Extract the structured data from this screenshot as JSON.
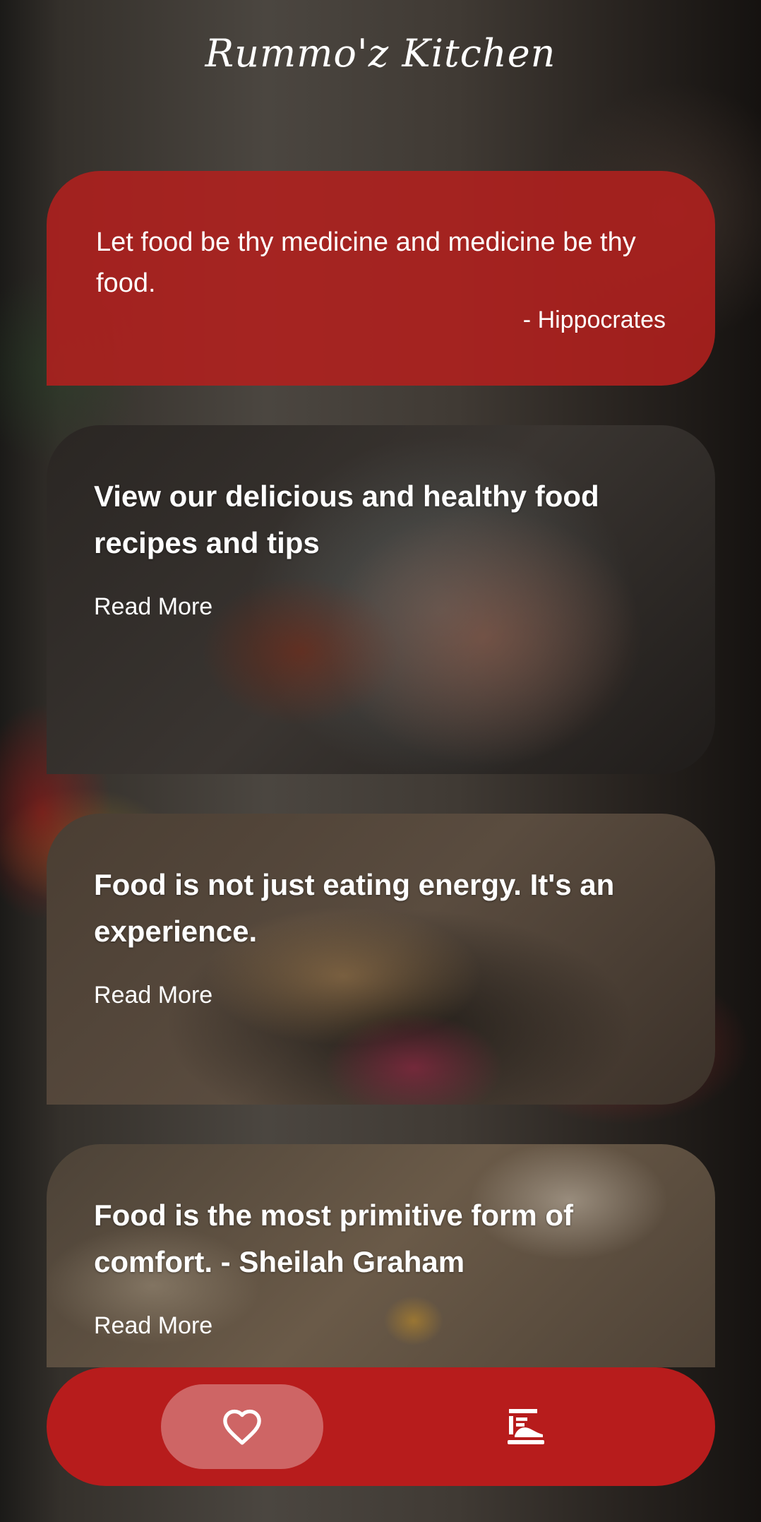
{
  "app": {
    "title": "Rummo'z Kitchen"
  },
  "quote": {
    "text": "Let food be thy medicine and medicine be thy food.",
    "author": "- Hippocrates"
  },
  "cards": [
    {
      "title": "View our delicious and healthy food recipes and tips",
      "link": "Read More"
    },
    {
      "title": "Food is not just eating energy. It's an experience.",
      "link": "Read More"
    },
    {
      "title": "Food is the most primitive form of comfort. - Sheilah Graham",
      "link": "Read More"
    }
  ],
  "nav": {
    "items": [
      {
        "icon": "heart-icon",
        "active": true
      },
      {
        "icon": "kitchen-icon",
        "active": false
      }
    ]
  },
  "colors": {
    "accent": "#b71c1c",
    "quote_bg": "#b2201e"
  }
}
